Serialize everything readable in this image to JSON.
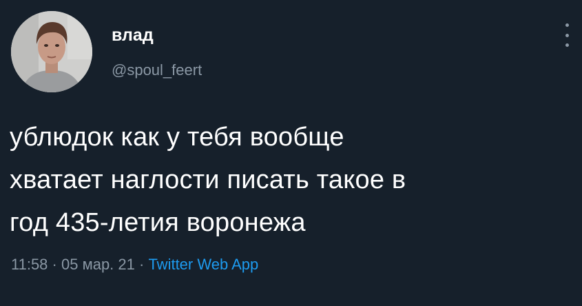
{
  "theme": {
    "background": "#16202b",
    "text_primary": "#ffffff",
    "text_secondary": "#8b98a5",
    "link": "#1d9bf0"
  },
  "author": {
    "name": "влад",
    "handle": "@spoul_feert",
    "avatar_icon": "profile-photo"
  },
  "tweet": {
    "lines": [
      "ублюдок как у тебя вообще",
      "хватает наглости писать такое в",
      "год 435-летия воронежа"
    ],
    "time": "11:58",
    "date": "05 мар. 21",
    "separator": "·",
    "source": "Twitter Web App"
  },
  "menu": {
    "icon": "more-vertical-icon"
  }
}
